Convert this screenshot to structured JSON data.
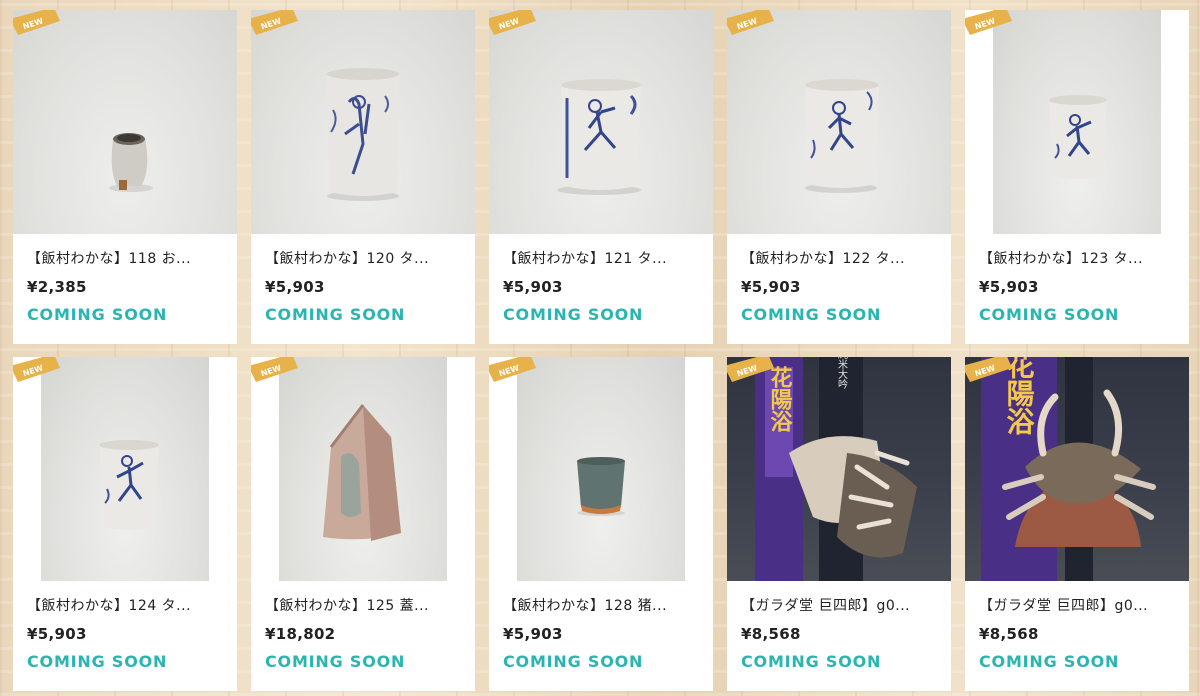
{
  "products": [
    {
      "title": "【飯村わかな】118 お...",
      "price": "¥2,385",
      "status": "COMING SOON",
      "badge": "NEW"
    },
    {
      "title": "【飯村わかな】120 タ...",
      "price": "¥5,903",
      "status": "COMING SOON",
      "badge": "NEW"
    },
    {
      "title": "【飯村わかな】121 タ...",
      "price": "¥5,903",
      "status": "COMING SOON",
      "badge": "NEW"
    },
    {
      "title": "【飯村わかな】122 タ...",
      "price": "¥5,903",
      "status": "COMING SOON",
      "badge": "NEW"
    },
    {
      "title": "【飯村わかな】123 タ...",
      "price": "¥5,903",
      "status": "COMING SOON",
      "badge": "NEW"
    },
    {
      "title": "【飯村わかな】124 タ...",
      "price": "¥5,903",
      "status": "COMING SOON",
      "badge": "NEW"
    },
    {
      "title": "【飯村わかな】125 蓋...",
      "price": "¥18,802",
      "status": "COMING SOON",
      "badge": "NEW"
    },
    {
      "title": "【飯村わかな】128 猪...",
      "price": "¥5,903",
      "status": "COMING SOON",
      "badge": "NEW"
    },
    {
      "title": "【ガラダ堂 巨四郎】g0...",
      "price": "¥8,568",
      "status": "COMING SOON",
      "badge": "NEW"
    },
    {
      "title": "【ガラダ堂 巨四郎】g0...",
      "price": "¥8,568",
      "status": "COMING SOON",
      "badge": "NEW"
    }
  ],
  "bottle_label": "花陽浴",
  "bottle_sublabel": "純米大吟",
  "colors": {
    "accent": "#2ab5b0",
    "badge": "#e8b24a"
  }
}
